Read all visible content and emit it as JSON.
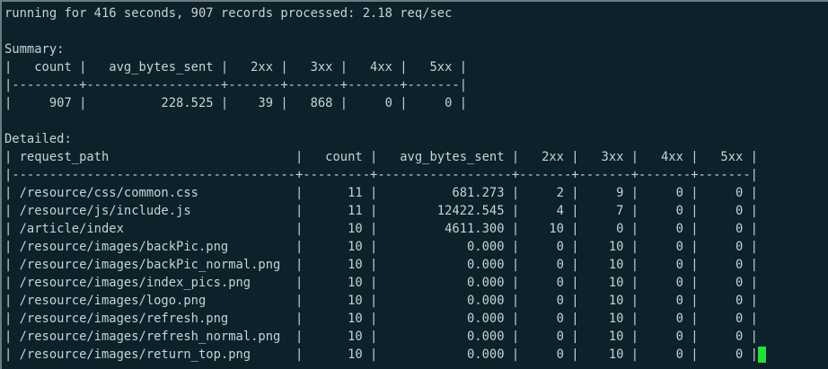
{
  "status_line": "running for 416 seconds, 907 records processed: 2.18 req/sec",
  "summary": {
    "title": "Summary:",
    "header": "|   count |   avg_bytes_sent |   2xx |   3xx |   4xx |   5xx |",
    "separator": "|---------+------------------+-------+-------+-------+-------|",
    "rows": [
      "|     907 |          228.525 |    39 |   868 |     0 |     0 |"
    ]
  },
  "detailed": {
    "title": "Detailed:",
    "header": "| request_path                         |   count |   avg_bytes_sent |   2xx |   3xx |   4xx |   5xx |",
    "separator": "|--------------------------------------+---------+------------------+-------+-------+-------+-------|",
    "rows": [
      "| /resource/css/common.css             |      11 |          681.273 |     2 |     9 |     0 |     0 |",
      "| /resource/js/include.js              |      11 |        12422.545 |     4 |     7 |     0 |     0 |",
      "| /article/index                       |      10 |         4611.300 |    10 |     0 |     0 |     0 |",
      "| /resource/images/backPic.png         |      10 |            0.000 |     0 |    10 |     0 |     0 |",
      "| /resource/images/backPic_normal.png  |      10 |            0.000 |     0 |    10 |     0 |     0 |",
      "| /resource/images/index_pics.png      |      10 |            0.000 |     0 |    10 |     0 |     0 |",
      "| /resource/images/logo.png            |      10 |            0.000 |     0 |    10 |     0 |     0 |",
      "| /resource/images/refresh.png         |      10 |            0.000 |     0 |    10 |     0 |     0 |",
      "| /resource/images/refresh_normal.png  |      10 |            0.000 |     0 |    10 |     0 |     0 |",
      "| /resource/images/return_top.png      |      10 |            0.000 |     0 |    10 |     0 |     0 |"
    ]
  },
  "colors": {
    "background": "#0c2129",
    "foreground": "#c8d2d6",
    "cursor": "#22e033"
  }
}
